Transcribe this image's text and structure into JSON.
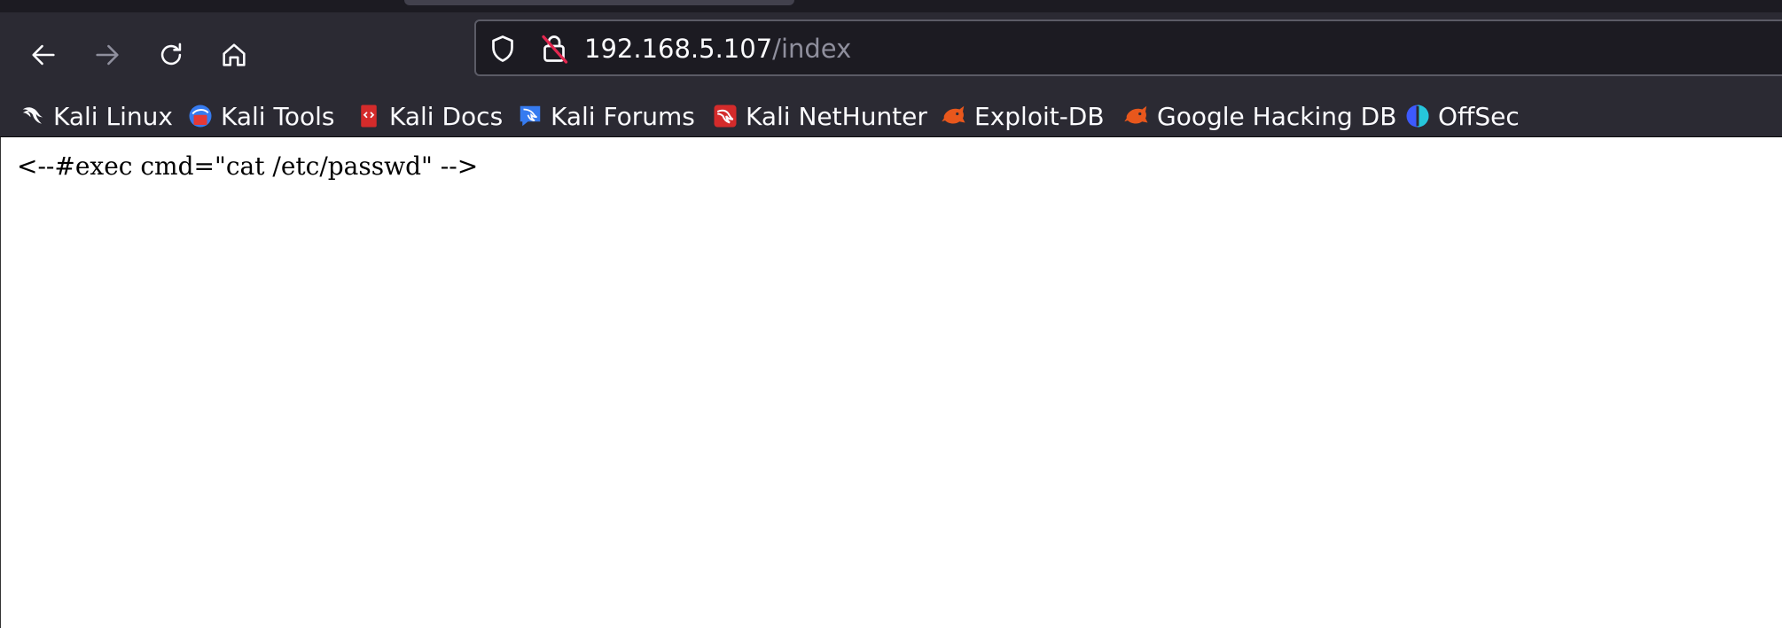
{
  "browser": {
    "url": {
      "host": "192.168.5.107",
      "path": "/index"
    },
    "icons": {
      "back": "arrow-left-icon",
      "forward": "arrow-right-icon",
      "reload": "reload-icon",
      "home": "home-icon",
      "tracking_protection": "shield-icon",
      "insecure_connection": "lock-crossed-icon"
    },
    "bookmarks": [
      {
        "label": "Kali Linux",
        "icon": "kali-dragon-icon"
      },
      {
        "label": "Kali Tools",
        "icon": "kali-tools-icon"
      },
      {
        "label": "Kali Docs",
        "icon": "kali-docs-icon"
      },
      {
        "label": "Kali Forums",
        "icon": "kali-forums-icon"
      },
      {
        "label": "Kali NetHunter",
        "icon": "kali-nethunter-icon"
      },
      {
        "label": "Exploit-DB",
        "icon": "exploit-db-icon"
      },
      {
        "label": "Google Hacking DB",
        "icon": "google-hacking-db-icon"
      },
      {
        "label": "OffSec",
        "icon": "offsec-icon"
      }
    ],
    "colors": {
      "toolbar": "#2b2a33",
      "urlbar": "#1c1b22",
      "exploit_orange": "#e8571c"
    }
  },
  "page": {
    "body_text": "<--#exec cmd=\"cat /etc/passwd\" -->"
  }
}
